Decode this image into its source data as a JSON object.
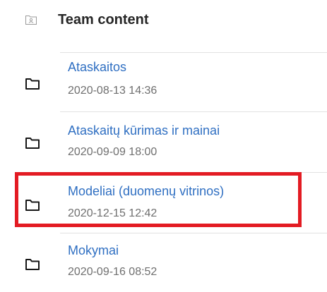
{
  "header": {
    "icon": "team-folder-icon",
    "title": "Team content"
  },
  "folders": [
    {
      "icon": "folder-icon",
      "name": "Ataskaitos",
      "date": "2020-08-13 14:36"
    },
    {
      "icon": "folder-icon",
      "name": "Ataskaitų kūrimas ir mainai",
      "date": "2020-09-09 18:00"
    },
    {
      "icon": "folder-icon",
      "name": "Modeliai (duomenų vitrinos)",
      "date": "2020-12-15 12:42",
      "highlighted": true
    },
    {
      "icon": "folder-icon",
      "name": "Mokymai",
      "date": "2020-09-16 08:52"
    }
  ],
  "colors": {
    "link": "#2f6fc2",
    "meta": "#6f6f6f",
    "title": "#262626",
    "highlight": "#e31b23"
  }
}
